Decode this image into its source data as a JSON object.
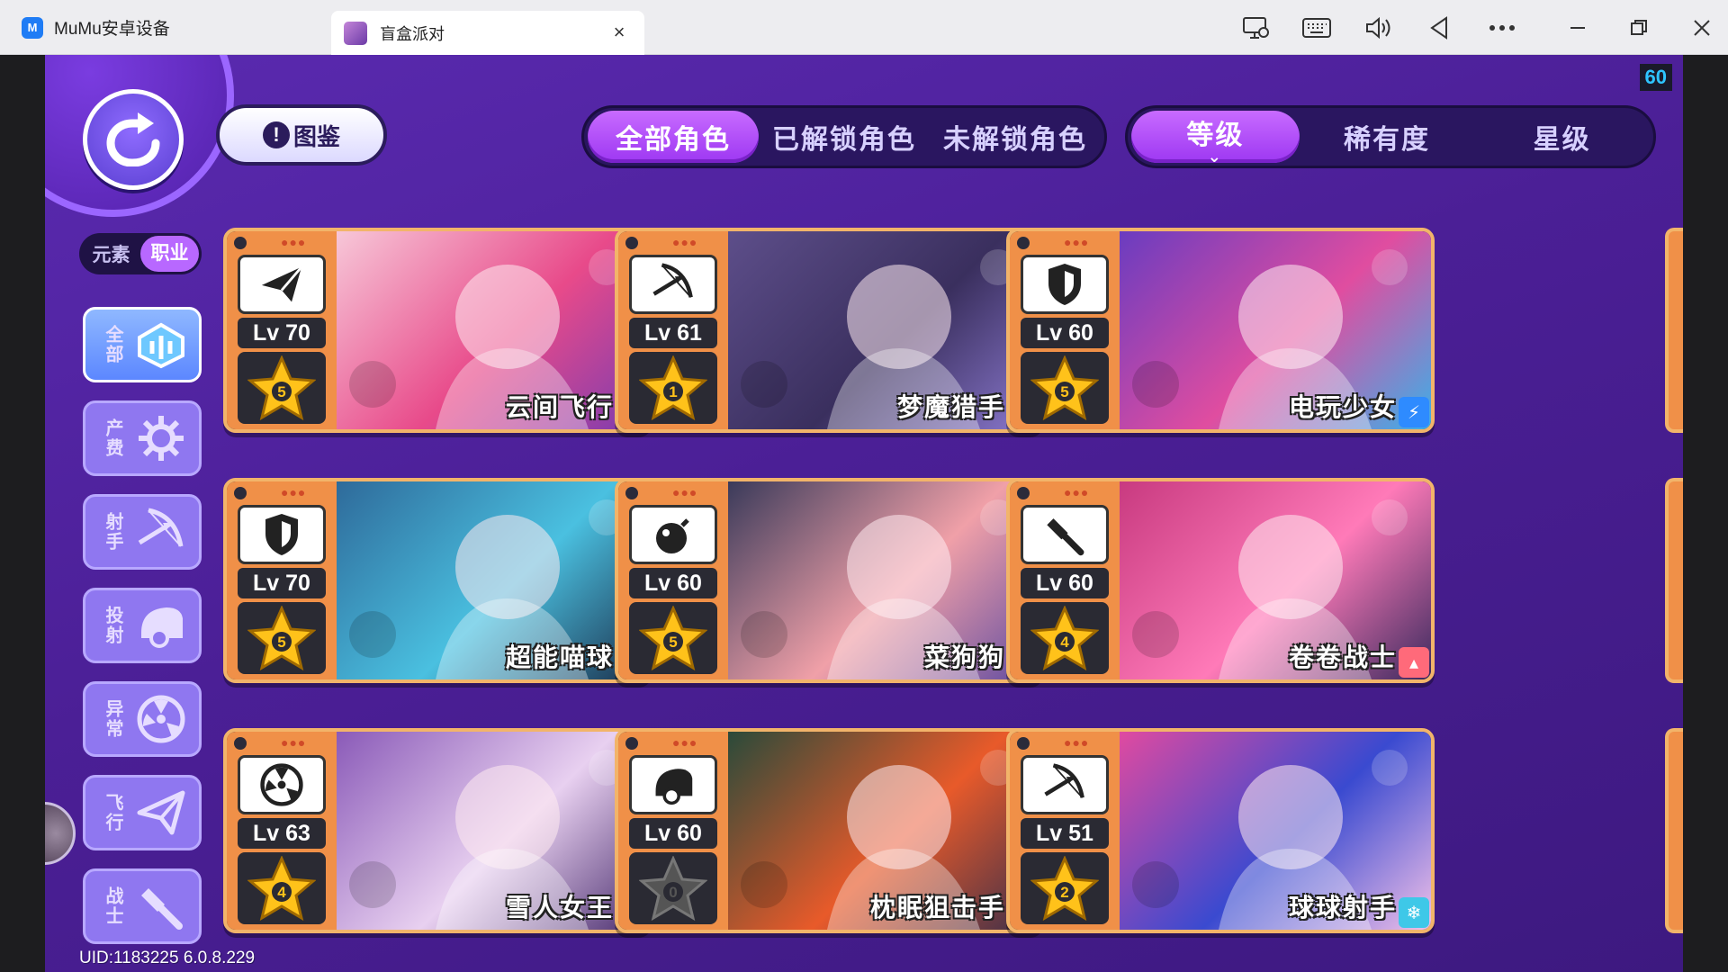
{
  "titlebar": {
    "app_name": "MuMu安卓设备",
    "app_logo_text": "M",
    "game_tab_title": "盲盒派对",
    "close_tab_symbol": "×"
  },
  "game": {
    "fps": "60",
    "codex_label": "图鉴",
    "codex_badge": "!",
    "filter_tabs": [
      {
        "label": "全部角色",
        "active": true
      },
      {
        "label": "已解锁角色",
        "active": false
      },
      {
        "label": "未解锁角色",
        "active": false
      }
    ],
    "sort_tabs": [
      {
        "label": "等级",
        "active": true
      },
      {
        "label": "稀有度",
        "active": false
      },
      {
        "label": "星级",
        "active": false
      }
    ],
    "sort_chevron": "⌄",
    "toggle": {
      "element": "元素",
      "job": "职业"
    },
    "categories": [
      {
        "label": "全部",
        "icon": "all-icon",
        "active": true
      },
      {
        "label": "产费",
        "icon": "gear-icon",
        "active": false
      },
      {
        "label": "射手",
        "icon": "bow-icon",
        "active": false
      },
      {
        "label": "投射",
        "icon": "cannon-icon",
        "active": false
      },
      {
        "label": "异常",
        "icon": "radiation-icon",
        "active": false
      },
      {
        "label": "飞行",
        "icon": "paper-plane-icon",
        "active": false
      },
      {
        "label": "战士",
        "icon": "hammer-icon",
        "active": false
      }
    ],
    "uid": "UID:1183225 6.0.8.229",
    "cards": [
      {
        "name": "云间飞行",
        "level": "Lv 70",
        "stars": "5",
        "job_icon": "paper-plane-icon",
        "element": "lightning",
        "element_color": "#2e8bff",
        "art": [
          "#f7c7d8",
          "#e84a8a",
          "#7a3cb0"
        ]
      },
      {
        "name": "梦魔猎手",
        "level": "Lv 61",
        "stars": "1",
        "job_icon": "bow-icon",
        "element": "triangle",
        "element_color": "#8a4cff",
        "art": [
          "#5d4e8a",
          "#3a2f5e",
          "#8c7ad0"
        ]
      },
      {
        "name": "电玩少女",
        "level": "Lv 60",
        "stars": "5",
        "job_icon": "shield-icon",
        "element": "lightning",
        "element_color": "#2e8bff",
        "art": [
          "#6a3cc0",
          "#e04da0",
          "#3bb0e8"
        ]
      },
      {
        "name": "超能喵球",
        "level": "Lv 70",
        "stars": "5",
        "job_icon": "shield-icon",
        "element": "lightning",
        "element_color": "#2e8bff",
        "art": [
          "#2e6a9a",
          "#4ac0e0",
          "#1a2e4a"
        ]
      },
      {
        "name": "菜狗狗",
        "level": "Lv 60",
        "stars": "5",
        "job_icon": "bomb-icon",
        "element": "moon",
        "element_color": "#4aa8ff",
        "art": [
          "#3a3a5a",
          "#f0a0a8",
          "#5e4aa0"
        ]
      },
      {
        "name": "卷卷战士",
        "level": "Lv 60",
        "stars": "4",
        "job_icon": "hammer-icon",
        "element": "cake",
        "element_color": "#ff6a7a",
        "art": [
          "#c83a80",
          "#ff7ab8",
          "#3a2a5e"
        ]
      },
      {
        "name": "雪人女王",
        "level": "Lv 63",
        "stars": "4",
        "job_icon": "radiation-icon",
        "element": "snowflake",
        "element_color": "#3ec8e8",
        "art": [
          "#8a5ab8",
          "#e8d0f0",
          "#4a2e6e"
        ]
      },
      {
        "name": "枕眠狙击手",
        "level": "Lv 60",
        "stars": "0",
        "job_icon": "cannon-icon",
        "element": "star",
        "element_color": "#ffb020",
        "art": [
          "#2a4a3a",
          "#e85a2a",
          "#3a2e4a"
        ]
      },
      {
        "name": "球球射手",
        "level": "Lv 51",
        "stars": "2",
        "job_icon": "bow-icon",
        "element": "snowflake",
        "element_color": "#3ec8e8",
        "art": [
          "#e04aa0",
          "#3a4ad0",
          "#f0c0e8"
        ]
      }
    ]
  }
}
